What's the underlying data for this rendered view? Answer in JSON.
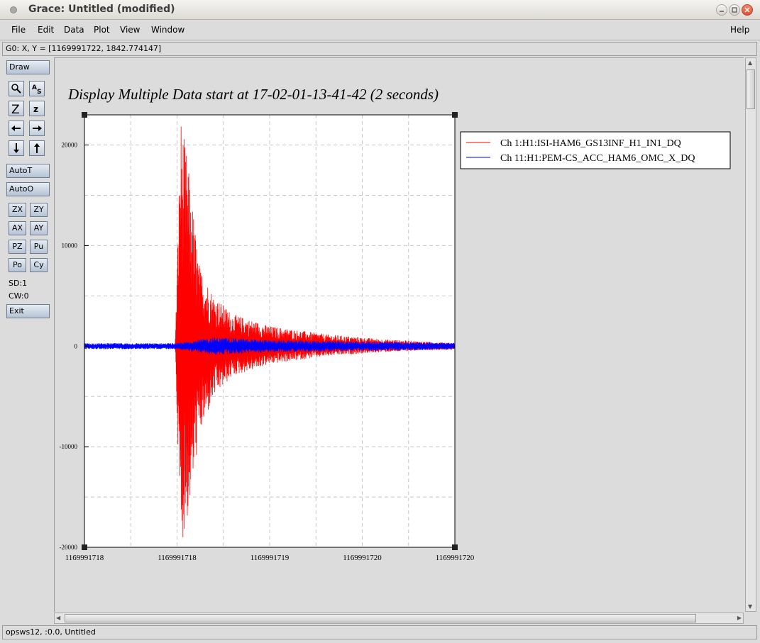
{
  "window": {
    "title": "Grace: Untitled (modified)"
  },
  "menubar": {
    "items": [
      "File",
      "Edit",
      "Data",
      "Plot",
      "View",
      "Window"
    ],
    "help": "Help"
  },
  "locator": {
    "text": "G0: X, Y = [1169991722, 1842.774147]"
  },
  "toolbar": {
    "draw": "Draw",
    "autot": "AutoT",
    "autoo": "AutoO",
    "zx": "ZX",
    "zy": "ZY",
    "ax": "AX",
    "ay": "AY",
    "pz": "PZ",
    "pu": "Pu",
    "po": "Po",
    "cy": "Cy",
    "sd": "SD:1",
    "cw": "CW:0",
    "exit": "Exit"
  },
  "statusbar": {
    "text": "opsws12, :0.0, Untitled"
  },
  "chart_data": {
    "type": "line",
    "title": "Display Multiple Data start at 17-02-01-13-41-42 (2 seconds)",
    "xlabel": "",
    "ylabel": "",
    "ylim": [
      -20000,
      23000
    ],
    "yticks": [
      {
        "label": "20000",
        "value": 20000
      },
      {
        "label": "10000",
        "value": 10000
      },
      {
        "label": "0",
        "value": 0
      },
      {
        "label": "-10000",
        "value": -10000
      },
      {
        "label": "-20000",
        "value": -20000
      }
    ],
    "xticks": [
      "1169991718",
      "1169991718",
      "1169991719",
      "1169991720",
      "1169991720"
    ],
    "grid": true,
    "legend_position": "right, outside plot",
    "series": [
      {
        "name": "Ch 1:H1:ISI-HAM6_GS13INF_H1_IN1_DQ",
        "color": "#ff0000",
        "envelope": [
          [
            1169991718.0,
            150
          ],
          [
            1169991718.49,
            150
          ],
          [
            1169991718.52,
            23000
          ],
          [
            1169991718.56,
            18000
          ],
          [
            1169991718.62,
            8000
          ],
          [
            1169991718.7,
            5000
          ],
          [
            1169991718.8,
            3200
          ],
          [
            1169991719.0,
            2000
          ],
          [
            1169991719.3,
            1200
          ],
          [
            1169991719.6,
            700
          ],
          [
            1169991720.0,
            300
          ]
        ],
        "min_envelope": [
          [
            1169991718.0,
            -150
          ],
          [
            1169991718.49,
            -150
          ],
          [
            1169991718.52,
            -20000
          ],
          [
            1169991718.56,
            -17000
          ],
          [
            1169991718.62,
            -9000
          ],
          [
            1169991718.7,
            -5000
          ],
          [
            1169991718.8,
            -3000
          ],
          [
            1169991719.0,
            -1800
          ],
          [
            1169991719.3,
            -1000
          ],
          [
            1169991719.6,
            -600
          ],
          [
            1169991720.0,
            -300
          ]
        ]
      },
      {
        "name": "Ch 11:H1:PEM-CS_ACC_HAM6_OMC_X_DQ",
        "color": "#0000ff",
        "envelope": [
          [
            1169991718.0,
            300
          ],
          [
            1169991718.5,
            300
          ],
          [
            1169991718.7,
            900
          ],
          [
            1169991719.0,
            600
          ],
          [
            1169991720.0,
            350
          ]
        ],
        "min_envelope": [
          [
            1169991718.0,
            -300
          ],
          [
            1169991718.5,
            -300
          ],
          [
            1169991718.7,
            -900
          ],
          [
            1169991719.0,
            -600
          ],
          [
            1169991720.0,
            -350
          ]
        ]
      }
    ],
    "xlim": [
      1169991718.0,
      1169991720.0
    ]
  }
}
